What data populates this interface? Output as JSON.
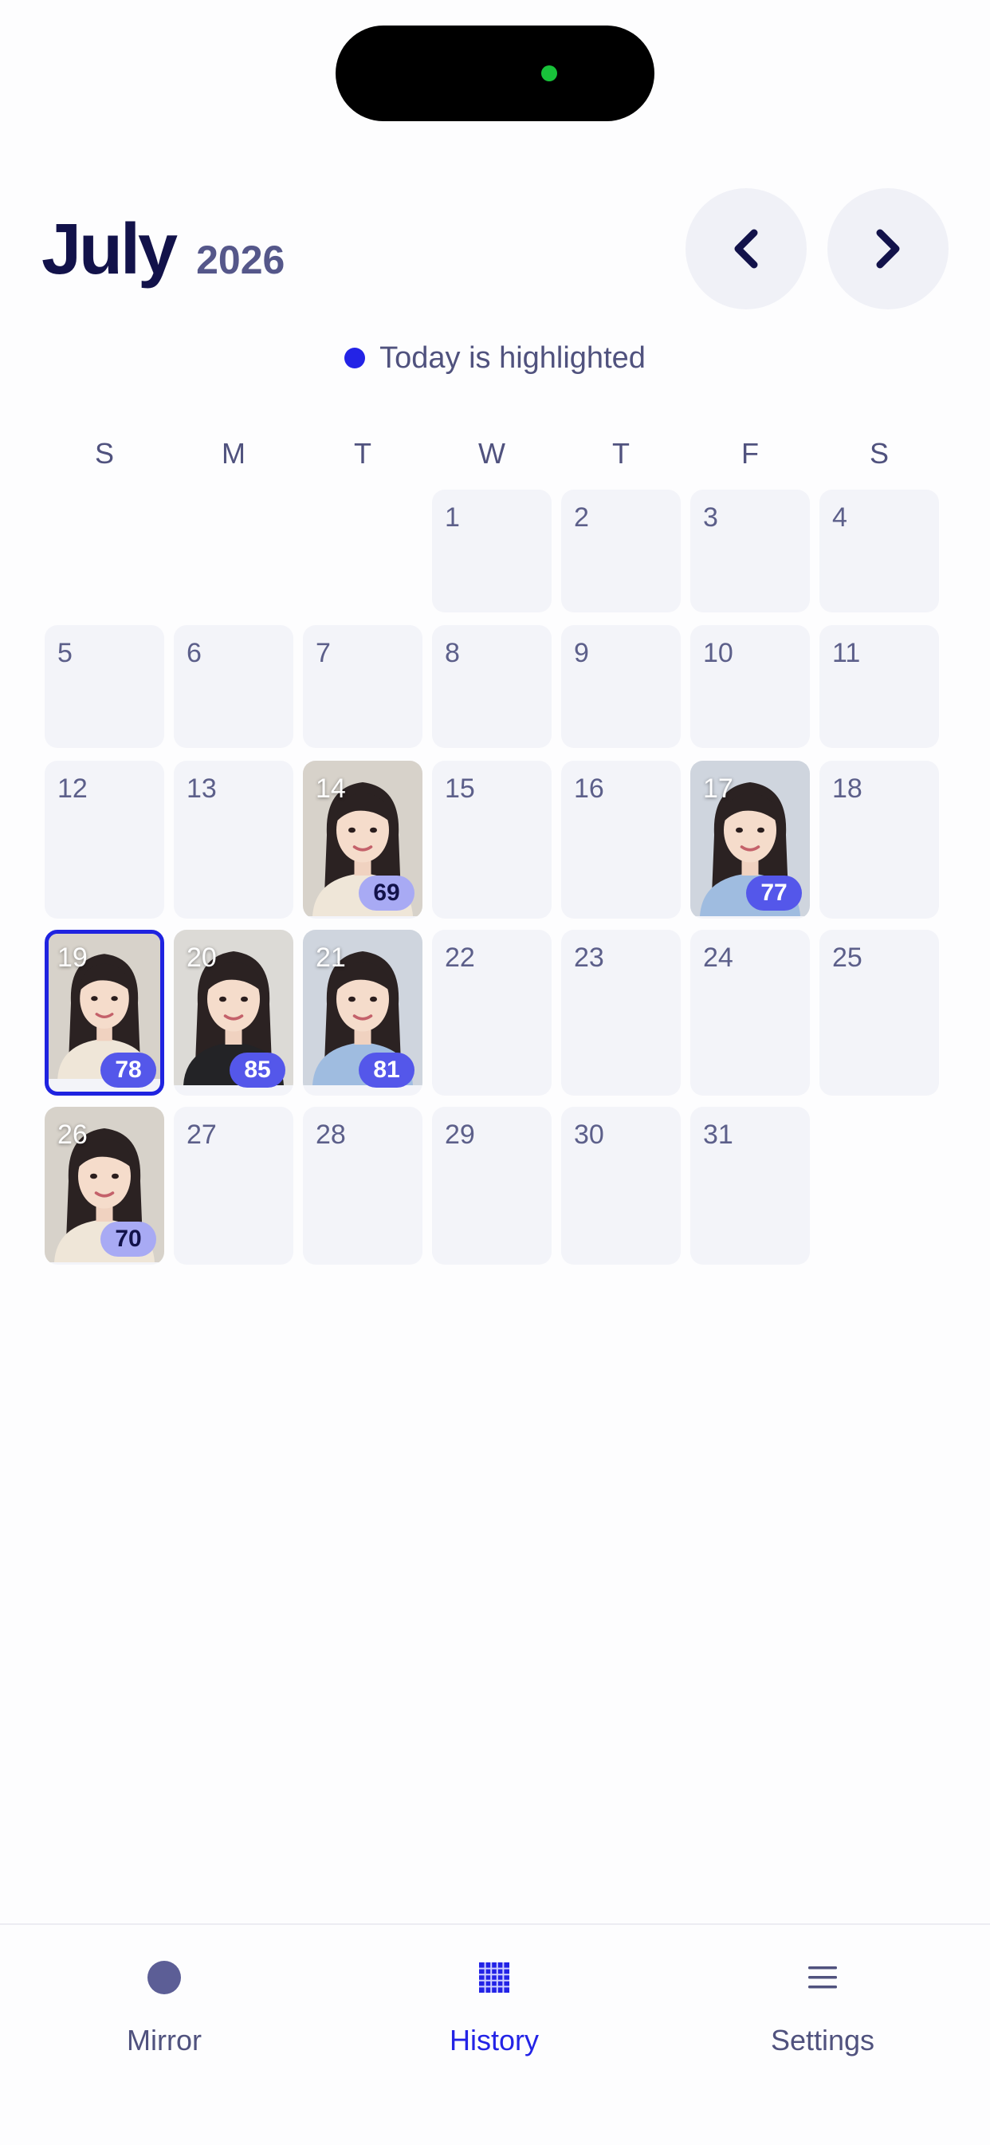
{
  "header": {
    "month": "July",
    "year": "2026",
    "prev_icon": "chevron-left-icon",
    "next_icon": "chevron-right-icon"
  },
  "legend": {
    "text": "Today is highlighted",
    "dot_color": "#2323e6"
  },
  "weekdays": [
    "S",
    "M",
    "T",
    "W",
    "T",
    "F",
    "S"
  ],
  "calendar": {
    "first_weekday": 3,
    "days_in_month": 31,
    "today": 19,
    "entries": [
      {
        "day": 14,
        "score": "69",
        "outfit": "cream"
      },
      {
        "day": 17,
        "score": "77",
        "outfit": "blue"
      },
      {
        "day": 19,
        "score": "78",
        "outfit": "cream"
      },
      {
        "day": 20,
        "score": "85",
        "outfit": "black"
      },
      {
        "day": 21,
        "score": "81",
        "outfit": "blue"
      },
      {
        "day": 26,
        "score": "70",
        "outfit": "cream"
      }
    ]
  },
  "colors": {
    "accent": "#2323e6",
    "badge_high": "#5457ea",
    "badge_low": "#a8aaf4",
    "cell_bg": "#f3f4f9"
  },
  "tabs": [
    {
      "label": "Mirror",
      "icon": "circle-icon",
      "active": false
    },
    {
      "label": "History",
      "icon": "calendar-grid-icon",
      "active": true
    },
    {
      "label": "Settings",
      "icon": "menu-icon",
      "active": false
    }
  ]
}
